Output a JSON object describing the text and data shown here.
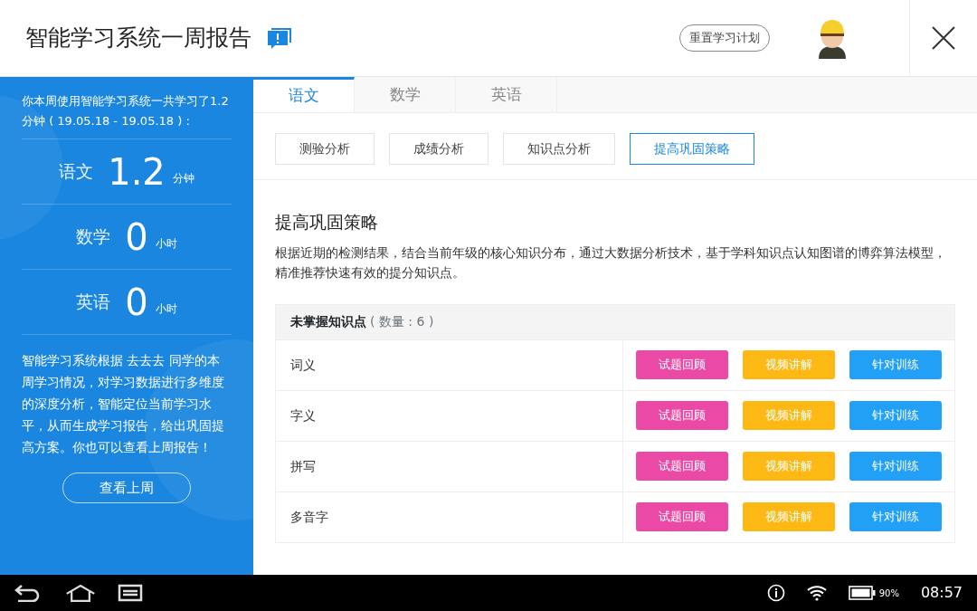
{
  "header": {
    "title": "智能学习系统一周报告",
    "reset_button": "重置学习计划"
  },
  "sidebar": {
    "intro": "你本周使用智能学习系统一共学习了1.2分钟 ( 19.05.18 - 19.05.18 ) :",
    "stats": [
      {
        "subject": "语文",
        "value": "1.2",
        "unit": "分钟"
      },
      {
        "subject": "数学",
        "value": "0",
        "unit": "小时"
      },
      {
        "subject": "英语",
        "value": "0",
        "unit": "小时"
      }
    ],
    "description": "智能学习系统根据 去去去 同学的本周学习情况，对学习数据进行多维度的深度分析，智能定位当前学习水平，从而生成学习报告，给出巩固提高方案。你也可以查看上周报告！",
    "last_week_button": "查看上周"
  },
  "tabs": [
    {
      "label": "语文",
      "selected": true
    },
    {
      "label": "数学",
      "selected": false
    },
    {
      "label": "英语",
      "selected": false
    }
  ],
  "subtabs": [
    {
      "label": "测验分析",
      "selected": false
    },
    {
      "label": "成绩分析",
      "selected": false
    },
    {
      "label": "知识点分析",
      "selected": false
    },
    {
      "label": "提高巩固策略",
      "selected": true
    }
  ],
  "section": {
    "title": "提高巩固策略",
    "text": "根据近期的检测结果，结合当前年级的核心知识分布，通过大数据分析技术，基于学科知识点认知图谱的博弈算法模型，精准推荐快速有效的提分知识点。"
  },
  "table": {
    "title": "未掌握知识点",
    "count": "( 数量 : 6 )",
    "rows": [
      {
        "name": "词义",
        "actions": [
          {
            "label": "试题回顾",
            "color": "#ea4aa6"
          },
          {
            "label": "视频讲解",
            "color": "#fdb813"
          },
          {
            "label": "针对训练",
            "color": "#22a0f5"
          }
        ]
      },
      {
        "name": "字义",
        "actions": [
          {
            "label": "试题回顾",
            "color": "#ea4aa6"
          },
          {
            "label": "视频讲解",
            "color": "#fdb813"
          },
          {
            "label": "针对训练",
            "color": "#22a0f5"
          }
        ]
      },
      {
        "name": "拼写",
        "actions": [
          {
            "label": "试题回顾",
            "color": "#ea4aa6"
          },
          {
            "label": "视频讲解",
            "color": "#fdb813"
          },
          {
            "label": "针对训练",
            "color": "#22a0f5"
          }
        ]
      },
      {
        "name": "多音字",
        "actions": [
          {
            "label": "试题回顾",
            "color": "#ea4aa6"
          },
          {
            "label": "视频讲解",
            "color": "#fdb813"
          },
          {
            "label": "针对训练",
            "color": "#22a0f5"
          }
        ]
      }
    ]
  },
  "status_bar": {
    "battery": "90%",
    "time": "08:57"
  }
}
